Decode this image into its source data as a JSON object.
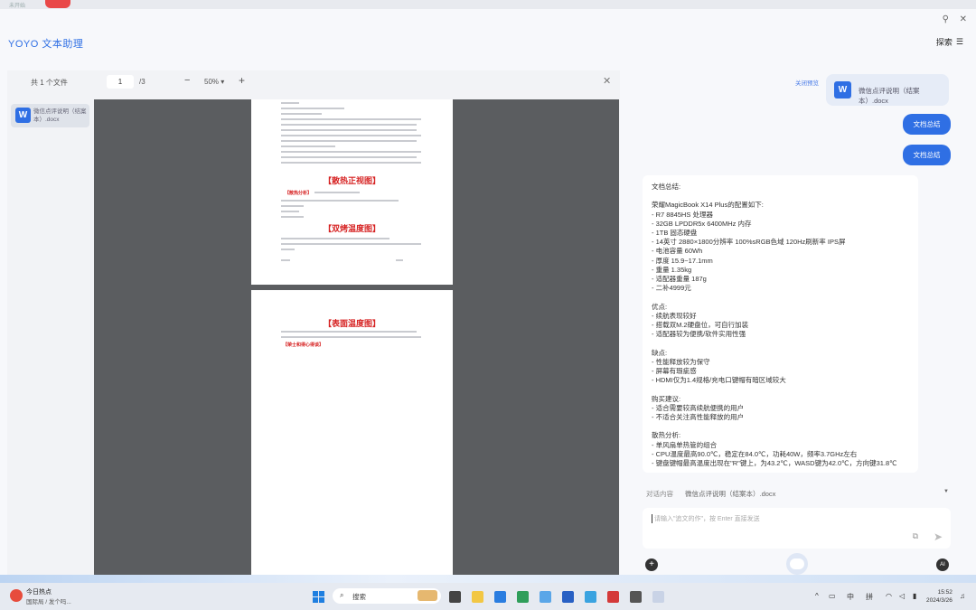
{
  "topbar": {
    "tiny_text": "未开始"
  },
  "app": {
    "title": "YOYO 文本助理",
    "explore_label": "探索",
    "pin_icon": "pin-icon",
    "close_icon": "close-icon"
  },
  "viewer": {
    "file_count": "共 1 个文件",
    "current_page": "1",
    "total_pages": "/3",
    "zoom": "50%",
    "file_name": "微信点评说明（结案本）.docx",
    "page1_heading1": "【散热正视图】",
    "page1_heading2": "【双烤温度图】",
    "page1_red_label": "【散热分析】",
    "page2_heading": "【表面温度图】",
    "page2_red_label": "【荣士和得心得谈】"
  },
  "chat": {
    "close_preview": "关闭预览",
    "file_bubble_name": "微信点评说明（结案本）.docx",
    "buttons": [
      "文档总结",
      "文档总结"
    ],
    "answer": "文档总结:\n\n荣耀MagicBook X14 Plus的配置如下:\n- R7 8845HS 处理器\n- 32GB LPDDR5x 6400MHz 内存\n- 1TB 固态硬盘\n- 14英寸 2880×1800分辨率 100%sRGB色域 120Hz刷新率 IPS屏\n- 电池容量 60Wh\n- 厚度 15.9~17.1mm\n- 重量 1.35kg\n- 适配器重量 187g\n- 二补4999元\n\n优点:\n- 续航表现较好\n- 搭载双M.2硬盘位，可自行加装\n- 适配器较为便携/软件实用性强\n\n缺点:\n- 性能释放较为保守\n- 屏幕有瑕疵感\n- HDMI仅为1.4规格/充电口键帽有暗区域较大\n\n购买建议:\n- 适合需要较高续航便携的用户\n- 不适合关注高性能释放的用户\n\n散热分析:\n- 单风扇单热管的组合\n- CPU温度最高90.0℃，稳定在84.0℃，功耗40W，频率3.7GHz左右\n- 键盘键帽最高温度出现在\"R\"键上，为43.2℃，WASD键为42.0℃，方向键31.8℃",
    "context_label": "对话内容",
    "context_file": "微信点评说明（结案本）.docx",
    "input_placeholder": "请输入\"追文的作\"，按 Enter 直接发送",
    "at_icon": "at-icon",
    "send_icon": "send-icon",
    "plus_icon": "plus-icon",
    "ai_label": "AI"
  },
  "taskbar": {
    "news_title": "今日热点",
    "news_sub": "国际局 / 发个吗...",
    "search_label": "搜索",
    "tray_lang": "中",
    "tray_ime": "拼",
    "time": "15:52",
    "date": "2024/3/26"
  }
}
